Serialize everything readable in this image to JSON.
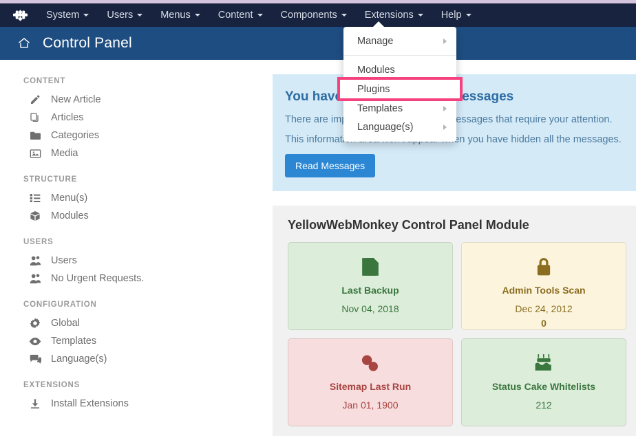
{
  "branding": {
    "logo_icon": "joomla-logo-icon"
  },
  "menubar": {
    "items": [
      {
        "label": "System",
        "icon": "chevron-down-icon"
      },
      {
        "label": "Users",
        "icon": "chevron-down-icon"
      },
      {
        "label": "Menus",
        "icon": "chevron-down-icon"
      },
      {
        "label": "Content",
        "icon": "chevron-down-icon"
      },
      {
        "label": "Components",
        "icon": "chevron-down-icon"
      },
      {
        "label": "Extensions",
        "icon": "chevron-down-icon"
      },
      {
        "label": "Help",
        "icon": "chevron-down-icon"
      }
    ]
  },
  "dropdown": {
    "open_for": "Extensions",
    "highlight_color": "#f5427e",
    "items": [
      {
        "label": "Manage",
        "has_submenu": true,
        "highlighted": false
      },
      {
        "label": "Modules",
        "has_submenu": false,
        "highlighted": false
      },
      {
        "label": "Plugins",
        "has_submenu": false,
        "highlighted": true
      },
      {
        "label": "Templates",
        "has_submenu": true,
        "highlighted": false
      },
      {
        "label": "Language(s)",
        "has_submenu": true,
        "highlighted": false
      }
    ]
  },
  "page_header": {
    "icon": "home-icon",
    "title": "Control Panel",
    "background": "#1e4d81"
  },
  "sidebar": {
    "groups": [
      {
        "title": "CONTENT",
        "items": [
          {
            "label": "New Article",
            "icon": "pencil-icon"
          },
          {
            "label": "Articles",
            "icon": "copy-icon"
          },
          {
            "label": "Categories",
            "icon": "folder-icon"
          },
          {
            "label": "Media",
            "icon": "image-icon"
          }
        ]
      },
      {
        "title": "STRUCTURE",
        "items": [
          {
            "label": "Menu(s)",
            "icon": "list-icon"
          },
          {
            "label": "Modules",
            "icon": "cube-icon"
          }
        ]
      },
      {
        "title": "USERS",
        "items": [
          {
            "label": "Users",
            "icon": "users-icon"
          },
          {
            "label": "No Urgent Requests.",
            "icon": "users-icon"
          }
        ]
      },
      {
        "title": "CONFIGURATION",
        "items": [
          {
            "label": "Global",
            "icon": "gear-icon"
          },
          {
            "label": "Templates",
            "icon": "eye-icon"
          },
          {
            "label": "Language(s)",
            "icon": "comment-icon"
          }
        ]
      },
      {
        "title": "EXTENSIONS",
        "items": [
          {
            "label": "Install Extensions",
            "icon": "download-icon"
          }
        ]
      }
    ]
  },
  "messages_panel": {
    "title": "You have post-installation messages",
    "line1": "There are important post-installation messages that require your attention.",
    "line2": "This information area won't appear when you have hidden all the messages.",
    "button_label": "Read Messages",
    "button_color": "#2b87d4",
    "background": "#d4eaf7"
  },
  "module_panel": {
    "title": "YellowWebMonkey Control Panel Module",
    "cards": [
      {
        "label": "Last Backup",
        "value": "Nov 04, 2018",
        "value2": "",
        "tone": "green",
        "icon": "floppy-disk-icon"
      },
      {
        "label": "Admin Tools Scan",
        "value": "Dec 24, 2012",
        "value2": "0",
        "tone": "amber",
        "icon": "lock-icon"
      },
      {
        "label": "Sitemap Last Run",
        "value": "Jan 01, 1900",
        "value2": "",
        "tone": "red",
        "icon": "chain-link-icon"
      },
      {
        "label": "Status Cake Whitelists",
        "value": "212",
        "value2": "",
        "tone": "green",
        "icon": "birthday-cake-icon"
      }
    ]
  }
}
